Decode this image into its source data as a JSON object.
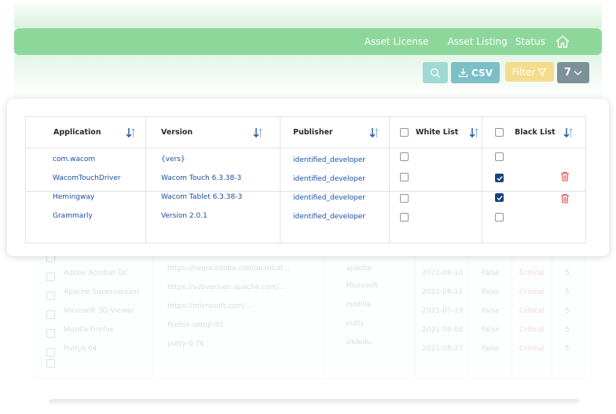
{
  "header": {
    "nav": [
      "Asset License",
      "Asset Listing",
      "Status"
    ],
    "accent": "#8ed79a"
  },
  "toolbar": {
    "csv_label": "CSV",
    "filter_label": "Filter",
    "count": "7"
  },
  "table": {
    "columns": [
      "Application",
      "Version",
      "Publisher",
      "White List",
      "Black List"
    ],
    "rows": [
      {
        "application": "com.wacom",
        "version": "{vers}",
        "publisher": "identified_developer",
        "white": false,
        "black": false,
        "delete": false
      },
      {
        "application": "WacomTouchDriver",
        "version": "Wacom Touch 6.3.38-3",
        "publisher": "identified_developer",
        "white": false,
        "black": true,
        "delete": true
      },
      {
        "application": "Hemingway",
        "version": "Wacom Tablet 6.3.38-3",
        "publisher": "identified_developer",
        "white": false,
        "black": true,
        "delete": true
      },
      {
        "application": "Grammarly",
        "version": "Version 2.0.1",
        "publisher": "identified_developer",
        "white": false,
        "black": false,
        "delete": false
      }
    ]
  },
  "background_table": {
    "rows": [
      {
        "app": "Adobe Acrobat DC",
        "url": "https://helpx.adobe.com/acrobat...",
        "pub": "apache",
        "date": "2021-08-10",
        "flag": "False",
        "sev": "Critical",
        "n": "5"
      },
      {
        "app": "Apache Superversion",
        "url": "https://subversion.apache.com/...",
        "pub": "Microsoft",
        "date": "2021-08-11",
        "flag": "False",
        "sev": "Critical",
        "n": "5"
      },
      {
        "app": "Microsoft 3D Viewer",
        "url": "https://microsoft.com/...",
        "pub": "mozilla",
        "date": "2021-07-19",
        "flag": "False",
        "sev": "Critical",
        "n": "5"
      },
      {
        "app": "Mozilla Firefox",
        "url": "firefox-setup-95",
        "pub": "putty",
        "date": "2021-08-02",
        "flag": "False",
        "sev": "Critical",
        "n": "5"
      },
      {
        "app": "Puttys 64",
        "url": "putty-0.76",
        "pub": "slidedu",
        "date": "2021-08-17",
        "flag": "False",
        "sev": "Critical",
        "n": "5"
      }
    ]
  },
  "colors": {
    "link": "#1a4fa3",
    "checked": "#19427e",
    "delete": "#d9534f",
    "csv_button": "#7dbfc6",
    "filter_button": "#f4dc8c",
    "count_button": "#7d919a"
  },
  "icons": [
    "home-icon",
    "search-icon",
    "download-icon",
    "filter-icon",
    "chevron-down-icon",
    "sort-icon",
    "trash-icon"
  ]
}
